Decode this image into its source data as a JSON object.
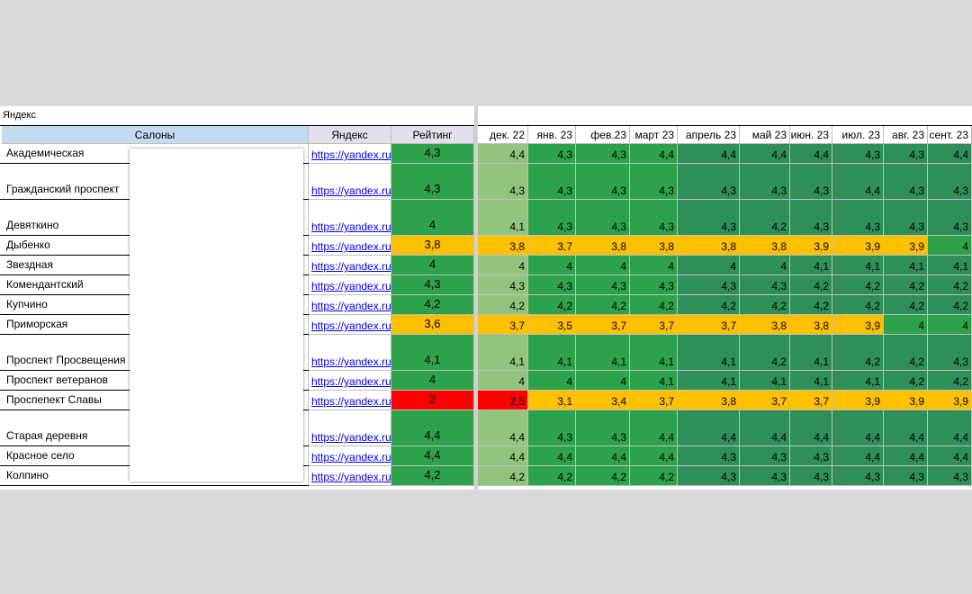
{
  "sheet_title": "Яндекс",
  "headers": {
    "salons": "Салоны",
    "yandex": "Яндекс",
    "rating": "Рейтинг",
    "months": [
      "дек. 22",
      "янв. 23",
      "фев.23",
      "март 23",
      "апрель 23",
      "май 23",
      "июн. 23",
      "июл. 23",
      "авг. 23",
      "сент. 23"
    ]
  },
  "colors": {
    "green": "#2ca34a",
    "dark_green": "#2e8f58",
    "light_green": "#93c47d",
    "orange": "#ffc000",
    "red": "#ff0000",
    "header_blue": "#c5d9f1",
    "header_purple": "#e4dfec",
    "link_bg": "#ffffff"
  },
  "rows": [
    {
      "name": "Академическая",
      "link": "https://yandex.ru",
      "rating": "4,3",
      "rating_color": "green",
      "months": [
        "4,4",
        "4,3",
        "4,3",
        "4,4",
        "4,4",
        "4,4",
        "4,4",
        "4,3",
        "4,3",
        "4,4"
      ],
      "month_colors": [
        "light_green",
        "green",
        "green",
        "green",
        "dark_green",
        "dark_green",
        "dark_green",
        "dark_green",
        "dark_green",
        "dark_green"
      ]
    },
    {
      "name": "Гражданский проспект",
      "link": "https://yandex.ru",
      "rating": "4,3",
      "rating_color": "green",
      "months": [
        "4,3",
        "4,3",
        "4,3",
        "4,3",
        "4,3",
        "4,3",
        "4,3",
        "4,4",
        "4,3",
        "4,3"
      ],
      "month_colors": [
        "light_green",
        "green",
        "green",
        "green",
        "dark_green",
        "dark_green",
        "dark_green",
        "dark_green",
        "dark_green",
        "dark_green"
      ]
    },
    {
      "name": "Девяткино",
      "link": "https://yandex.ru",
      "rating": "4",
      "rating_color": "green",
      "months": [
        "4,1",
        "4,3",
        "4,3",
        "4,3",
        "4,3",
        "4,2",
        "4,3",
        "4,3",
        "4,3",
        "4,3"
      ],
      "month_colors": [
        "light_green",
        "green",
        "green",
        "green",
        "dark_green",
        "dark_green",
        "dark_green",
        "dark_green",
        "dark_green",
        "dark_green"
      ]
    },
    {
      "name": "Дыбенко",
      "link": "https://yandex.ru",
      "rating": "3,8",
      "rating_color": "orange",
      "months": [
        "3,8",
        "3,7",
        "3,8",
        "3,8",
        "3,8",
        "3,8",
        "3,9",
        "3,9",
        "3,9",
        "4"
      ],
      "month_colors": [
        "orange",
        "orange",
        "orange",
        "orange",
        "orange",
        "orange",
        "orange",
        "orange",
        "orange",
        "green"
      ]
    },
    {
      "name": "Звездная",
      "link": "https://yandex.ru",
      "rating": "4",
      "rating_color": "green",
      "months": [
        "4",
        "4",
        "4",
        "4",
        "4",
        "4",
        "4,1",
        "4,1",
        "4,1",
        "4,1"
      ],
      "month_colors": [
        "light_green",
        "green",
        "green",
        "green",
        "dark_green",
        "dark_green",
        "dark_green",
        "dark_green",
        "dark_green",
        "dark_green"
      ]
    },
    {
      "name": "Комендантский",
      "link": "https://yandex.ru",
      "rating": "4,3",
      "rating_color": "green",
      "months": [
        "4,3",
        "4,3",
        "4,3",
        "4,3",
        "4,3",
        "4,3",
        "4,2",
        "4,2",
        "4,2",
        "4,2"
      ],
      "month_colors": [
        "light_green",
        "green",
        "green",
        "green",
        "dark_green",
        "dark_green",
        "dark_green",
        "dark_green",
        "dark_green",
        "dark_green"
      ]
    },
    {
      "name": "Купчино",
      "link": "https://yandex.ru",
      "rating": "4,2",
      "rating_color": "green",
      "months": [
        "4,2",
        "4,2",
        "4,2",
        "4,2",
        "4,2",
        "4,2",
        "4,2",
        "4,2",
        "4,2",
        "4,2"
      ],
      "month_colors": [
        "light_green",
        "green",
        "green",
        "green",
        "dark_green",
        "dark_green",
        "dark_green",
        "dark_green",
        "dark_green",
        "dark_green"
      ]
    },
    {
      "name": "Приморская",
      "link": "https://yandex.ru",
      "rating": "3,6",
      "rating_color": "orange",
      "months": [
        "3,7",
        "3,5",
        "3,7",
        "3,7",
        "3,7",
        "3,8",
        "3,8",
        "3,9",
        "4",
        "4"
      ],
      "month_colors": [
        "orange",
        "orange",
        "orange",
        "orange",
        "orange",
        "orange",
        "orange",
        "orange",
        "green",
        "green"
      ]
    },
    {
      "name": "Проспект Просвещения",
      "link": "https://yandex.ru",
      "rating": "4,1",
      "rating_color": "green",
      "months": [
        "4,1",
        "4,1",
        "4,1",
        "4,1",
        "4,1",
        "4,2",
        "4,1",
        "4,2",
        "4,2",
        "4,3"
      ],
      "month_colors": [
        "light_green",
        "green",
        "green",
        "green",
        "dark_green",
        "dark_green",
        "dark_green",
        "dark_green",
        "dark_green",
        "dark_green"
      ]
    },
    {
      "name": "Проспект ветеранов",
      "link": "https://yandex.ru",
      "rating": "4",
      "rating_color": "green",
      "months": [
        "4",
        "4",
        "4",
        "4,1",
        "4,1",
        "4,1",
        "4,1",
        "4,1",
        "4,2",
        "4,2"
      ],
      "month_colors": [
        "light_green",
        "green",
        "green",
        "green",
        "dark_green",
        "dark_green",
        "dark_green",
        "dark_green",
        "dark_green",
        "dark_green"
      ]
    },
    {
      "name": "Проспепект Славы",
      "link": "https://yandex.ru",
      "rating": "2",
      "rating_color": "red",
      "months": [
        "2,5",
        "3,1",
        "3,4",
        "3,7",
        "3,8",
        "3,7",
        "3,7",
        "3,9",
        "3,9",
        "3,9"
      ],
      "month_colors": [
        "red",
        "orange",
        "orange",
        "orange",
        "orange",
        "orange",
        "orange",
        "orange",
        "orange",
        "orange"
      ]
    },
    {
      "name": "Старая деревня",
      "link": "https://yandex.ru",
      "rating": "4,4",
      "rating_color": "green",
      "months": [
        "4,4",
        "4,3",
        "4,3",
        "4,4",
        "4,4",
        "4,4",
        "4,4",
        "4,4",
        "4,4",
        "4,4"
      ],
      "month_colors": [
        "light_green",
        "green",
        "green",
        "green",
        "dark_green",
        "dark_green",
        "dark_green",
        "dark_green",
        "dark_green",
        "dark_green"
      ]
    },
    {
      "name": "Красное село",
      "link": "https://yandex.ru",
      "rating": "4,4",
      "rating_color": "green",
      "months": [
        "4,4",
        "4,4",
        "4,4",
        "4,4",
        "4,3",
        "4,3",
        "4,3",
        "4,4",
        "4,4",
        "4,4"
      ],
      "month_colors": [
        "light_green",
        "green",
        "green",
        "green",
        "dark_green",
        "dark_green",
        "dark_green",
        "dark_green",
        "dark_green",
        "dark_green"
      ]
    },
    {
      "name": "Колпино",
      "link": "https://yandex.ru",
      "rating": "4,2",
      "rating_color": "green",
      "months": [
        "4,2",
        "4,2",
        "4,2",
        "4,2",
        "4,3",
        "4,3",
        "4,3",
        "4,3",
        "4,3",
        "4,3"
      ],
      "month_colors": [
        "light_green",
        "green",
        "green",
        "green",
        "dark_green",
        "dark_green",
        "dark_green",
        "dark_green",
        "dark_green",
        "dark_green"
      ]
    }
  ]
}
